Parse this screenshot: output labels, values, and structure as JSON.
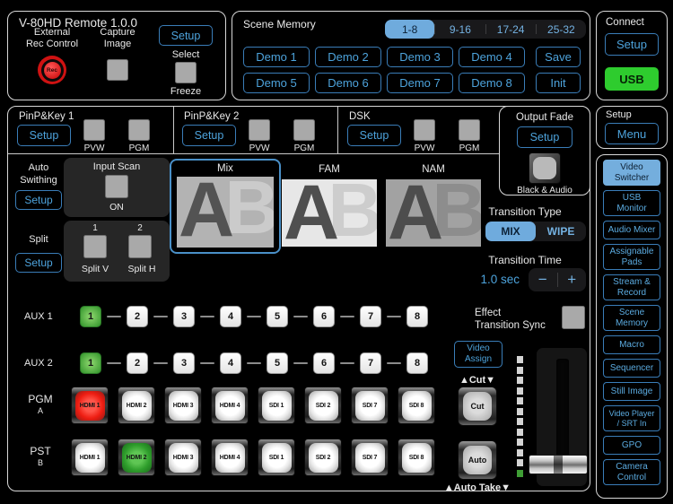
{
  "colors": {
    "accent_blue": "#4da3dc",
    "selected_blue": "#6fabdd",
    "usb_green": "#2ecc2e",
    "led_green": "#3f9e35",
    "active_red": "#ee1d12",
    "active_green": "#2f9e2c",
    "panel_border": "#d8d8d8"
  },
  "device": {
    "title": "V-80HD Remote 1.0.0",
    "external_rec_line1": "External",
    "external_rec_line2": "Rec Control",
    "rec_label": "Rec",
    "capture_line1": "Capture",
    "capture_line2": "Image",
    "setup_label": "Setup",
    "select_label": "Select",
    "freeze_label": "Freeze"
  },
  "scene_memory": {
    "title": "Scene Memory",
    "tabs": [
      "1-8",
      "9-16",
      "17-24",
      "25-32"
    ],
    "selected_tab": "1-8",
    "demo_row1": [
      "Demo 1",
      "Demo 2",
      "Demo 3",
      "Demo 4"
    ],
    "demo_row2": [
      "Demo 5",
      "Demo 6",
      "Demo 7",
      "Demo 8"
    ],
    "save_label": "Save",
    "init_label": "Init"
  },
  "connect": {
    "title": "Connect",
    "setup_label": "Setup",
    "usb_label": "USB"
  },
  "setup_menu": {
    "title": "Setup",
    "menu_label": "Menu"
  },
  "keyers": [
    {
      "title": "PinP&Key 1",
      "setup_label": "Setup",
      "pvw_label": "PVW",
      "pgm_label": "PGM"
    },
    {
      "title": "PinP&Key 2",
      "setup_label": "Setup",
      "pvw_label": "PVW",
      "pgm_label": "PGM"
    },
    {
      "title": "DSK",
      "setup_label": "Setup",
      "pvw_label": "PVW",
      "pgm_label": "PGM"
    }
  ],
  "output_fade": {
    "title": "Output Fade",
    "setup_label": "Setup",
    "caption": "Black & Audio"
  },
  "auto_switching": {
    "line1": "Auto",
    "line2": "Swithing",
    "setup_label": "Setup"
  },
  "input_scan": {
    "title": "Input Scan",
    "state": "ON"
  },
  "split": {
    "title": "Split",
    "setup_label": "Setup",
    "btn1_num": "1",
    "btn1_label": "Split V",
    "btn2_num": "2",
    "btn2_label": "Split H"
  },
  "transition_preview": {
    "modes": [
      "Mix",
      "FAM",
      "NAM"
    ],
    "selected_mode": "Mix",
    "letter_a": "A",
    "letter_b": "B"
  },
  "transition_type": {
    "title": "Transition Type",
    "options": [
      "MIX",
      "WIPE"
    ],
    "selected": "MIX"
  },
  "transition_time": {
    "title": "Transition Time",
    "value": "1.0 sec",
    "minus": "−",
    "plus": "+"
  },
  "effect_sync": {
    "line1": "Effect",
    "line2": "Transition Sync"
  },
  "aux": {
    "aux1_label": "AUX 1",
    "aux2_label": "AUX 2",
    "buttons": [
      "1",
      "2",
      "3",
      "4",
      "5",
      "6",
      "7",
      "8"
    ],
    "aux1_active": "1",
    "aux2_active": "1"
  },
  "crosspoint": {
    "pgm_label": "PGM",
    "pgm_sub": "A",
    "pst_label": "PST",
    "pst_sub": "B",
    "inputs": [
      "HDMI 1",
      "HDMI 2",
      "HDMI 3",
      "HDMI 4",
      "SDI 1",
      "SDI 2",
      "SDI 7",
      "SDI 8"
    ],
    "pgm_active": "HDMI 1",
    "pst_active": "HDMI 2"
  },
  "take": {
    "video_assign_line1": "Video",
    "video_assign_line2": "Assign",
    "cut_caption": "▲Cut▼",
    "cut_label": "Cut",
    "auto_label": "Auto",
    "auto_caption": "▲Auto Take▼"
  },
  "sidebar": {
    "items": [
      {
        "line1": "Video",
        "line2": "Switcher",
        "selected": true
      },
      {
        "line1": "USB",
        "line2": "Monitor"
      },
      {
        "line1": "Audio Mixer",
        "line2": ""
      },
      {
        "line1": "Assignable",
        "line2": "Pads"
      },
      {
        "line1": "Stream &",
        "line2": "Record"
      },
      {
        "line1": "Scene",
        "line2": "Memory"
      },
      {
        "line1": "Macro",
        "line2": ""
      },
      {
        "line1": "Sequencer",
        "line2": ""
      },
      {
        "line1": "Still Image",
        "line2": ""
      },
      {
        "line1": "Video Player",
        "line2": "/ SRT In"
      },
      {
        "line1": "GPO",
        "line2": ""
      },
      {
        "line1": "Camera",
        "line2": "Control"
      }
    ]
  }
}
